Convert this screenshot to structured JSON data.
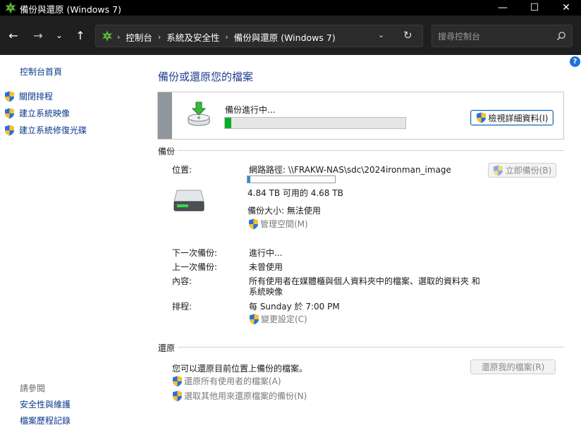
{
  "window": {
    "title": "備份與還原 (Windows 7)",
    "controls": {
      "minimize": "—",
      "maximize": "☐",
      "close": "✕"
    }
  },
  "addressbar": {
    "back": "←",
    "forward": "→",
    "recent": "⌄",
    "up": "↑",
    "breadcrumbs": [
      "控制台",
      "系統及安全性",
      "備份與還原 (Windows 7)"
    ],
    "separator": "›",
    "dropdown": "⌄",
    "refresh": "↻",
    "search_placeholder": "搜尋控制台"
  },
  "sidebar": {
    "home": "控制台首頁",
    "links": [
      "關閉排程",
      "建立系統映像",
      "建立系統修復光碟"
    ],
    "see_also": "請參閱",
    "bottom_links": [
      "安全性與維護",
      "檔案歷程記錄"
    ]
  },
  "help": "?",
  "main": {
    "title": "備份或還原您的檔案",
    "progress": {
      "label": "備份進行中...",
      "fraction": 0.035,
      "details_button": "檢視詳細資料(I)"
    },
    "backup": {
      "heading": "備份",
      "location_label": "位置:",
      "location_value": "網路路徑: \\\\FRAKW-NAS\\sdc\\2024ironman_image",
      "capacity_fraction": 0.03,
      "free_space": "4.84 TB 可用的 4.68 TB",
      "backup_size": "備份大小: 無法使用",
      "manage_space": "管理空間(M)",
      "backup_now": "立即備份(B)",
      "next_label": "下一次備份:",
      "next_value": "進行中...",
      "last_label": "上一次備份:",
      "last_value": "未曾使用",
      "contents_label": "內容:",
      "contents_line1": "所有使用者在媒體櫃與個人資料夾中的檔案、選取的資料夾 和",
      "contents_line2": "系統映像",
      "schedule_label": "排程:",
      "schedule_value": "每 Sunday 於 7:00 PM",
      "change_settings": "變更設定(C)"
    },
    "restore": {
      "heading": "還原",
      "description": "您可以還原目前位置上備份的檔案。",
      "restore_my_files": "還原我的檔案(R)",
      "restore_all_users": "還原所有使用者的檔案(A)",
      "select_other": "選取其他用來還原檔案的備份(N)"
    }
  },
  "colors": {
    "link": "#0a3a8a",
    "title": "#1e3d8f",
    "progress": "#06b025",
    "capacity": "#2a8fdc"
  }
}
